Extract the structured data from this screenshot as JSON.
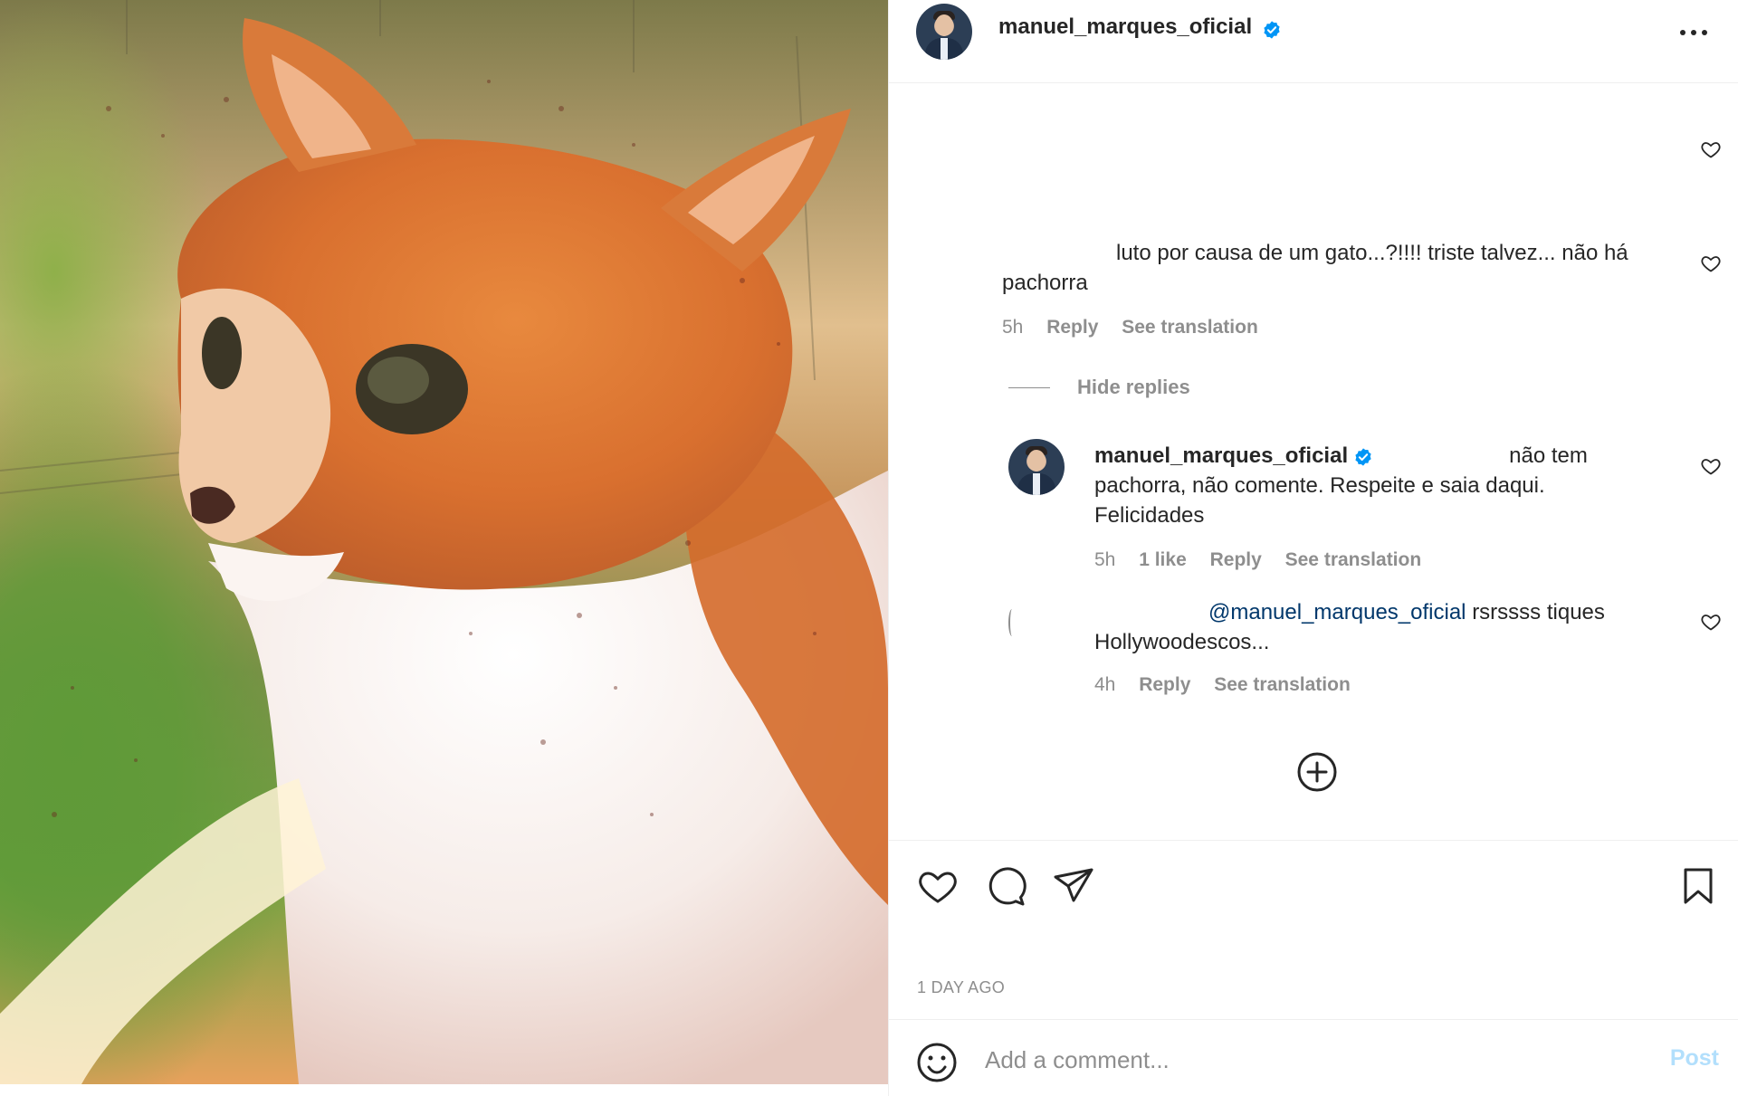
{
  "post": {
    "image_alt": "orange-and-white-cat-photo",
    "author": {
      "username": "manuel_marques_oficial",
      "verified": true
    },
    "date_label": "1 DAY AGO"
  },
  "comments": [
    {
      "text": "luto por causa de um gato...?!!!! triste talvez... não há pachorra",
      "time": "5h",
      "reply_label": "Reply",
      "translate_label": "See translation"
    }
  ],
  "hide_replies_label": "Hide replies",
  "replies": [
    {
      "username": "manuel_marques_oficial",
      "verified": true,
      "text": "não tem pachorra, não comente. Respeite e saia daqui. Felicidades",
      "time": "5h",
      "likes": "1 like",
      "reply_label": "Reply",
      "translate_label": "See translation"
    },
    {
      "mention": "@manuel_marques_oficial",
      "text": "rsrssss tiques Hollywoodescos...",
      "time": "4h",
      "reply_label": "Reply",
      "translate_label": "See translation"
    }
  ],
  "input": {
    "placeholder": "Add a comment...",
    "post_label": "Post"
  },
  "icons": [
    "more-icon",
    "heart-icon",
    "comment-icon",
    "share-icon",
    "bookmark-icon",
    "emoji-icon",
    "plus-circle-icon",
    "verified-badge-icon"
  ],
  "colors": {
    "verified": "#0095f6",
    "muted": "#8e8e8e",
    "post_disabled": "#b2dffc",
    "mention": "#00376b"
  }
}
